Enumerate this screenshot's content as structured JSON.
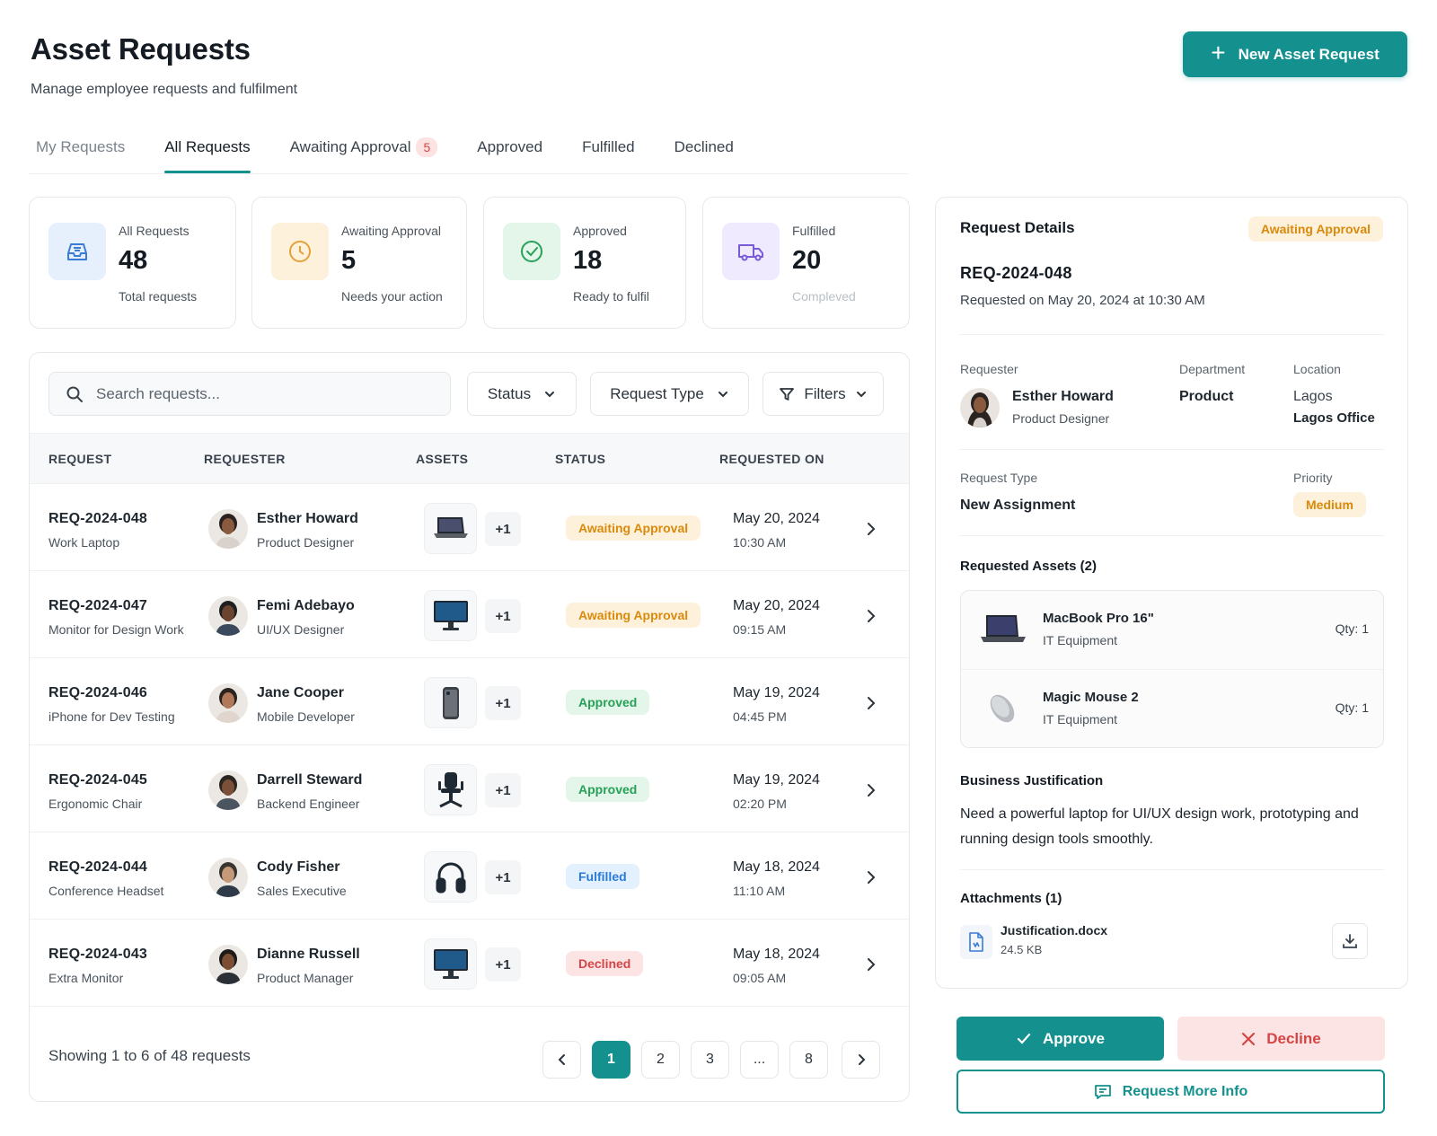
{
  "header": {
    "title": "Asset Requests",
    "subtitle": "Manage employee requests and fulfilment",
    "new_request_label": "New Asset Request"
  },
  "tabs": [
    {
      "label": "My Requests"
    },
    {
      "label": "All Requests",
      "active": true
    },
    {
      "label": "Awaiting Approval",
      "badge": "5"
    },
    {
      "label": "Approved"
    },
    {
      "label": "Fulfilled"
    },
    {
      "label": "Declined"
    }
  ],
  "stats": [
    {
      "label": "All Requests",
      "value": "48",
      "sub": "Total requests",
      "icon": "inbox-icon"
    },
    {
      "label": "Awaiting Approval",
      "value": "5",
      "sub": "Needs your action",
      "icon": "clock-icon"
    },
    {
      "label": "Approved",
      "value": "18",
      "sub": "Ready to fulfil",
      "icon": "check-circle-icon"
    },
    {
      "label": "Fulfilled",
      "value": "20",
      "sub": "Compleved",
      "icon": "truck-icon"
    }
  ],
  "filters": {
    "search_placeholder": "Search requests...",
    "status_label": "Status",
    "type_label": "Request Type",
    "filters_label": "Filters"
  },
  "table": {
    "columns": [
      "REQUEST",
      "REQUESTER",
      "ASSETS",
      "STATUS",
      "REQUESTED ON"
    ],
    "rows": [
      {
        "id": "REQ-2024-048",
        "title": "Work Laptop",
        "name": "Esther Howard",
        "role": "Product Designer",
        "asset": "laptop-icon",
        "more": "+1",
        "status": "Awaiting Approval",
        "status_kind": "awaiting",
        "date": "May 20, 2024",
        "time": "10:30 AM"
      },
      {
        "id": "REQ-2024-047",
        "title": "Monitor for Design Work",
        "name": "Femi Adebayo",
        "role": "UI/UX Designer",
        "asset": "monitor-icon",
        "more": "+1",
        "status": "Awaiting Approval",
        "status_kind": "awaiting",
        "date": "May 20, 2024",
        "time": "09:15 AM"
      },
      {
        "id": "REQ-2024-046",
        "title": "iPhone for Dev Testing",
        "name": "Jane Cooper",
        "role": "Mobile Developer",
        "asset": "phone-icon",
        "more": "+1",
        "status": "Approved",
        "status_kind": "approved",
        "date": "May 19, 2024",
        "time": "04:45 PM"
      },
      {
        "id": "REQ-2024-045",
        "title": "Ergonomic Chair",
        "name": "Darrell Steward",
        "role": "Backend Engineer",
        "asset": "chair-icon",
        "more": "+1",
        "status": "Approved",
        "status_kind": "approved",
        "date": "May 19, 2024",
        "time": "02:20 PM"
      },
      {
        "id": "REQ-2024-044",
        "title": "Conference Headset",
        "name": "Cody Fisher",
        "role": "Sales Executive",
        "asset": "headset-icon",
        "more": "+1",
        "status": "Fulfilled",
        "status_kind": "fulfilled",
        "date": "May 18, 2024",
        "time": "11:10 AM"
      },
      {
        "id": "REQ-2024-043",
        "title": "Extra Monitor",
        "name": "Dianne Russell",
        "role": "Product Manager",
        "asset": "monitor-icon",
        "more": "+1",
        "status": "Declined",
        "status_kind": "declined",
        "date": "May 18, 2024",
        "time": "09:05 AM"
      }
    ],
    "footer": "Showing 1 to 6 of 48 requests",
    "pages": [
      "1",
      "2",
      "3",
      "...",
      "8"
    ],
    "current_page": "1"
  },
  "details": {
    "title": "Request Details",
    "status": "Awaiting Approval",
    "id": "REQ-2024-048",
    "requested_on": "Requested on May 20, 2024 at 10:30 AM",
    "requester_label": "Requester",
    "requester_name": "Esther Howard",
    "requester_role": "Product Designer",
    "department_label": "Department",
    "department": "Product",
    "location_label": "Location",
    "location": "Lagos",
    "location_office": "Lagos Office",
    "type_label": "Request Type",
    "type": "New Assignment",
    "priority_label": "Priority",
    "priority": "Medium",
    "assets_title": "Requested Assets (2)",
    "assets": [
      {
        "name": "MacBook Pro 16\"",
        "category": "IT Equipment",
        "qty": "Qty: 1",
        "icon": "laptop-icon"
      },
      {
        "name": "Magic Mouse 2",
        "category": "IT Equipment",
        "qty": "Qty: 1",
        "icon": "mouse-icon"
      }
    ],
    "justification_title": "Business Justification",
    "justification": "Need a powerful laptop for UI/UX design work, prototyping and running design tools smoothly.",
    "attachments_title": "Attachments (1)",
    "attachment_name": "Justification.docx",
    "attachment_size": "24.5 KB",
    "approve_label": "Approve",
    "decline_label": "Decline",
    "more_info_label": "Request More Info"
  },
  "colors": {
    "accent": "#14918f",
    "awaiting": "#d98a0b",
    "approved": "#27a157",
    "fulfilled": "#2b7bd9",
    "declined": "#d64545"
  }
}
